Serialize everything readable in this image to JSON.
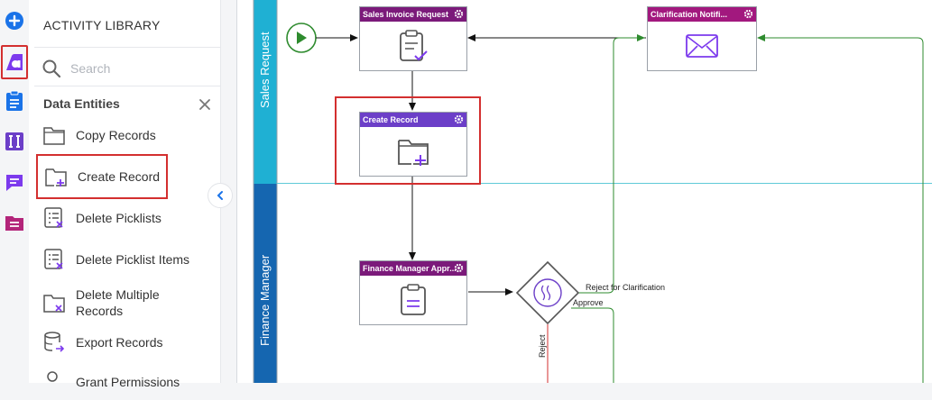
{
  "library": {
    "title": "ACTIVITY LIBRARY",
    "search_placeholder": "Search",
    "category": "Data Entities",
    "items": [
      {
        "label": "Copy Records",
        "icon": "folder-icon"
      },
      {
        "label": "Create Record",
        "icon": "folder-plus-icon"
      },
      {
        "label": "Delete Picklists",
        "icon": "list-delete-icon"
      },
      {
        "label": "Delete Picklist Items",
        "icon": "list-delete-icon"
      },
      {
        "label": "Delete Multiple Records",
        "icon": "folder-delete-icon"
      },
      {
        "label": "Export Records",
        "icon": "database-export-icon"
      },
      {
        "label": "Grant Permissions",
        "icon": "user-key-icon"
      }
    ]
  },
  "lanes": [
    {
      "label": "Sales Request",
      "color": "#1fb0d3"
    },
    {
      "label": "Finance Manager",
      "color": "#1566b0"
    }
  ],
  "nodes": {
    "sales_invoice": {
      "title": "Sales Invoice Request",
      "header_color": "#7b1a7a",
      "icon": "clipboard-check-icon"
    },
    "clarification": {
      "title": "Clarification Notifi...",
      "header_color": "#a2187e",
      "icon": "envelope-icon"
    },
    "create_record": {
      "title": "Create Record",
      "header_color": "#6c3fc8",
      "icon": "folder-plus-icon"
    },
    "finance_approval": {
      "title": "Finance Manager Appr...",
      "header_color": "#7b1a7a",
      "icon": "clipboard-list-icon"
    }
  },
  "edges": {
    "reject_clarification": "Reject for Clarification",
    "approve": "Approve",
    "reject": "Reject"
  },
  "colors": {
    "accent": "#7c3aed",
    "highlight": "#d32f2f",
    "flow_green": "#2e8b2e",
    "flow_red": "#d32f2f"
  }
}
